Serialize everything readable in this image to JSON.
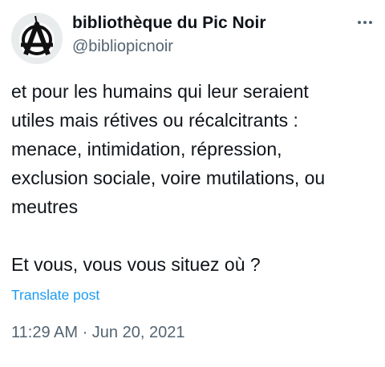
{
  "author": {
    "display_name": "bibliothèque du Pic Noir",
    "handle": "@bibliopicnoir",
    "avatar_icon": "anarchy-a-icon"
  },
  "post": {
    "text": "et pour les humains qui leur seraient\nutiles mais rétives ou récalcitrants :\nmenace, intimidation, répression,\nexclusion sociale, voire mutilations, ou\nmeutres\n\nEt vous, vous vous situez où ?",
    "translate_label": "Translate post",
    "timestamp": "11:29 AM · Jun 20, 2021"
  },
  "menu": {
    "more_icon": "more-horizontal-icon"
  },
  "colors": {
    "text_primary": "#0f1419",
    "text_secondary": "#536471",
    "link": "#1d9bf0"
  }
}
